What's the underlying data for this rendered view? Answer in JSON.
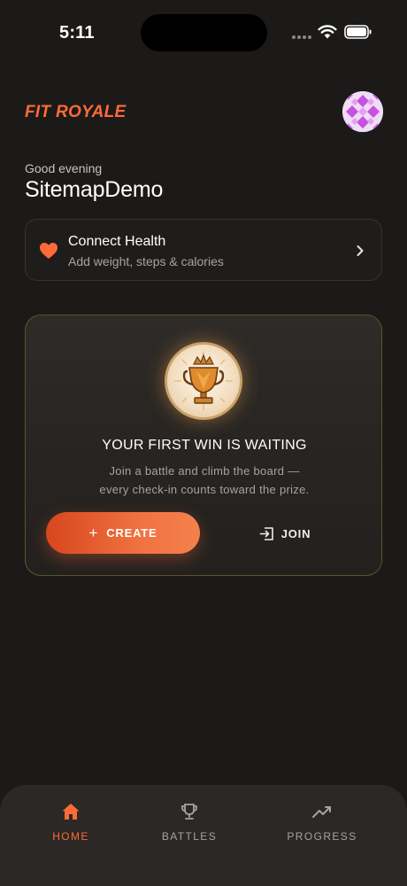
{
  "status_bar": {
    "time": "5:11"
  },
  "header": {
    "brand": "FIT ROYALE"
  },
  "greeting": {
    "text": "Good evening",
    "username": "SitemapDemo"
  },
  "health_card": {
    "title": "Connect Health",
    "subtitle": "Add weight, steps & calories"
  },
  "battle_card": {
    "title": "YOUR FIRST WIN IS WAITING",
    "description_line1": "Join a battle and climb the board —",
    "description_line2": "every check-in counts toward the prize.",
    "create_label": "CREATE",
    "join_label": "JOIN"
  },
  "bottom_nav": {
    "items": [
      {
        "label": "HOME",
        "icon": "home-icon",
        "active": true
      },
      {
        "label": "BATTLES",
        "icon": "trophy-icon",
        "active": false
      },
      {
        "label": "PROGRESS",
        "icon": "trend-icon",
        "active": false
      }
    ]
  },
  "colors": {
    "accent": "#ff6a38",
    "background": "#1c1a18",
    "card_border_gold": "#5c5328"
  }
}
